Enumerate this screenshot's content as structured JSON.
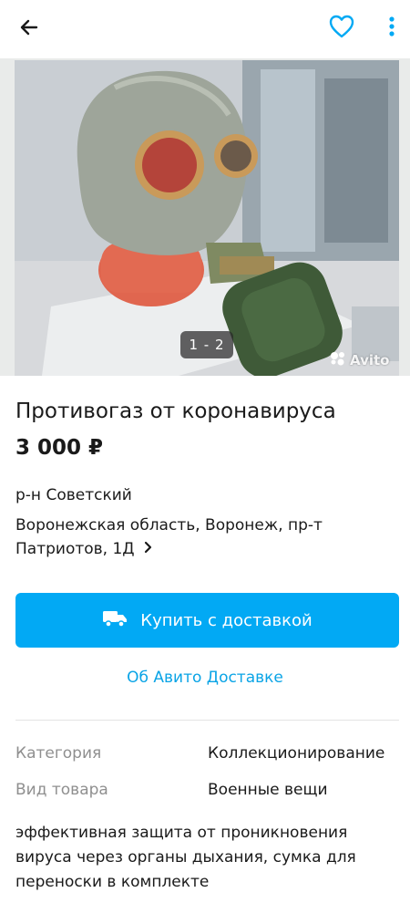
{
  "header": {
    "back_icon": "arrow-left-icon",
    "favorite_icon": "heart-outline-icon",
    "more_icon": "more-vertical-icon",
    "accent_color": "#02a9f4"
  },
  "gallery": {
    "counter": "1 - 2",
    "watermark": "Avito"
  },
  "listing": {
    "title": "Противогаз от коронавируса",
    "price": "3 000 ₽",
    "district": "р-н Советский",
    "address": "Воронежская область, Воронеж, пр-т Патриотов, 1Д"
  },
  "actions": {
    "buy_label": "Купить с доставкой",
    "buy_icon": "truck-icon",
    "delivery_info_label": "Об Авито Доставке"
  },
  "params": [
    {
      "label": "Категория",
      "value": "Коллекционирование"
    },
    {
      "label": "Вид товара",
      "value": "Военные вещи"
    }
  ],
  "description": "эффективная защита от проникновения вируса через органы дыхания, сумка для переноски в комплекте"
}
